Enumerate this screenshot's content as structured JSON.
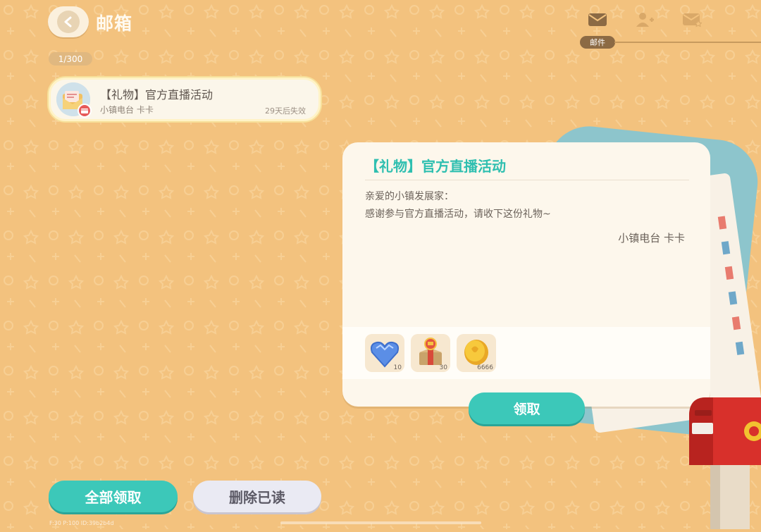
{
  "header": {
    "title": "邮箱",
    "counter": "1/300"
  },
  "tabs": {
    "active_label": "邮件",
    "items": [
      {
        "icon": "envelope-icon"
      },
      {
        "icon": "add-friend-icon"
      },
      {
        "icon": "envelope-star-icon"
      }
    ]
  },
  "mail_list": [
    {
      "title": "【礼物】官方直播活动",
      "sender": "小镇电台 卡卡",
      "expiry": "29天后失效"
    }
  ],
  "detail": {
    "title": "【礼物】官方直播活动",
    "greeting": "亲爱的小镇发展家：",
    "body": "感谢参与官方直播活动，请收下这份礼物~",
    "signature": "小镇电台 卡卡",
    "rewards": [
      {
        "icon": "blue-heart-gem-icon",
        "count": "10"
      },
      {
        "icon": "gift-box-icon",
        "count": "30"
      },
      {
        "icon": "gold-coin-icon",
        "count": "6666"
      }
    ],
    "claim_label": "领取"
  },
  "footer": {
    "claim_all_label": "全部领取",
    "delete_read_label": "删除已读"
  },
  "debug_text": "F:30   P:100   ID:39b2b4d",
  "colors": {
    "background": "#f3c27e",
    "accent_teal": "#3cc8b9",
    "card": "#fdf7ec"
  }
}
